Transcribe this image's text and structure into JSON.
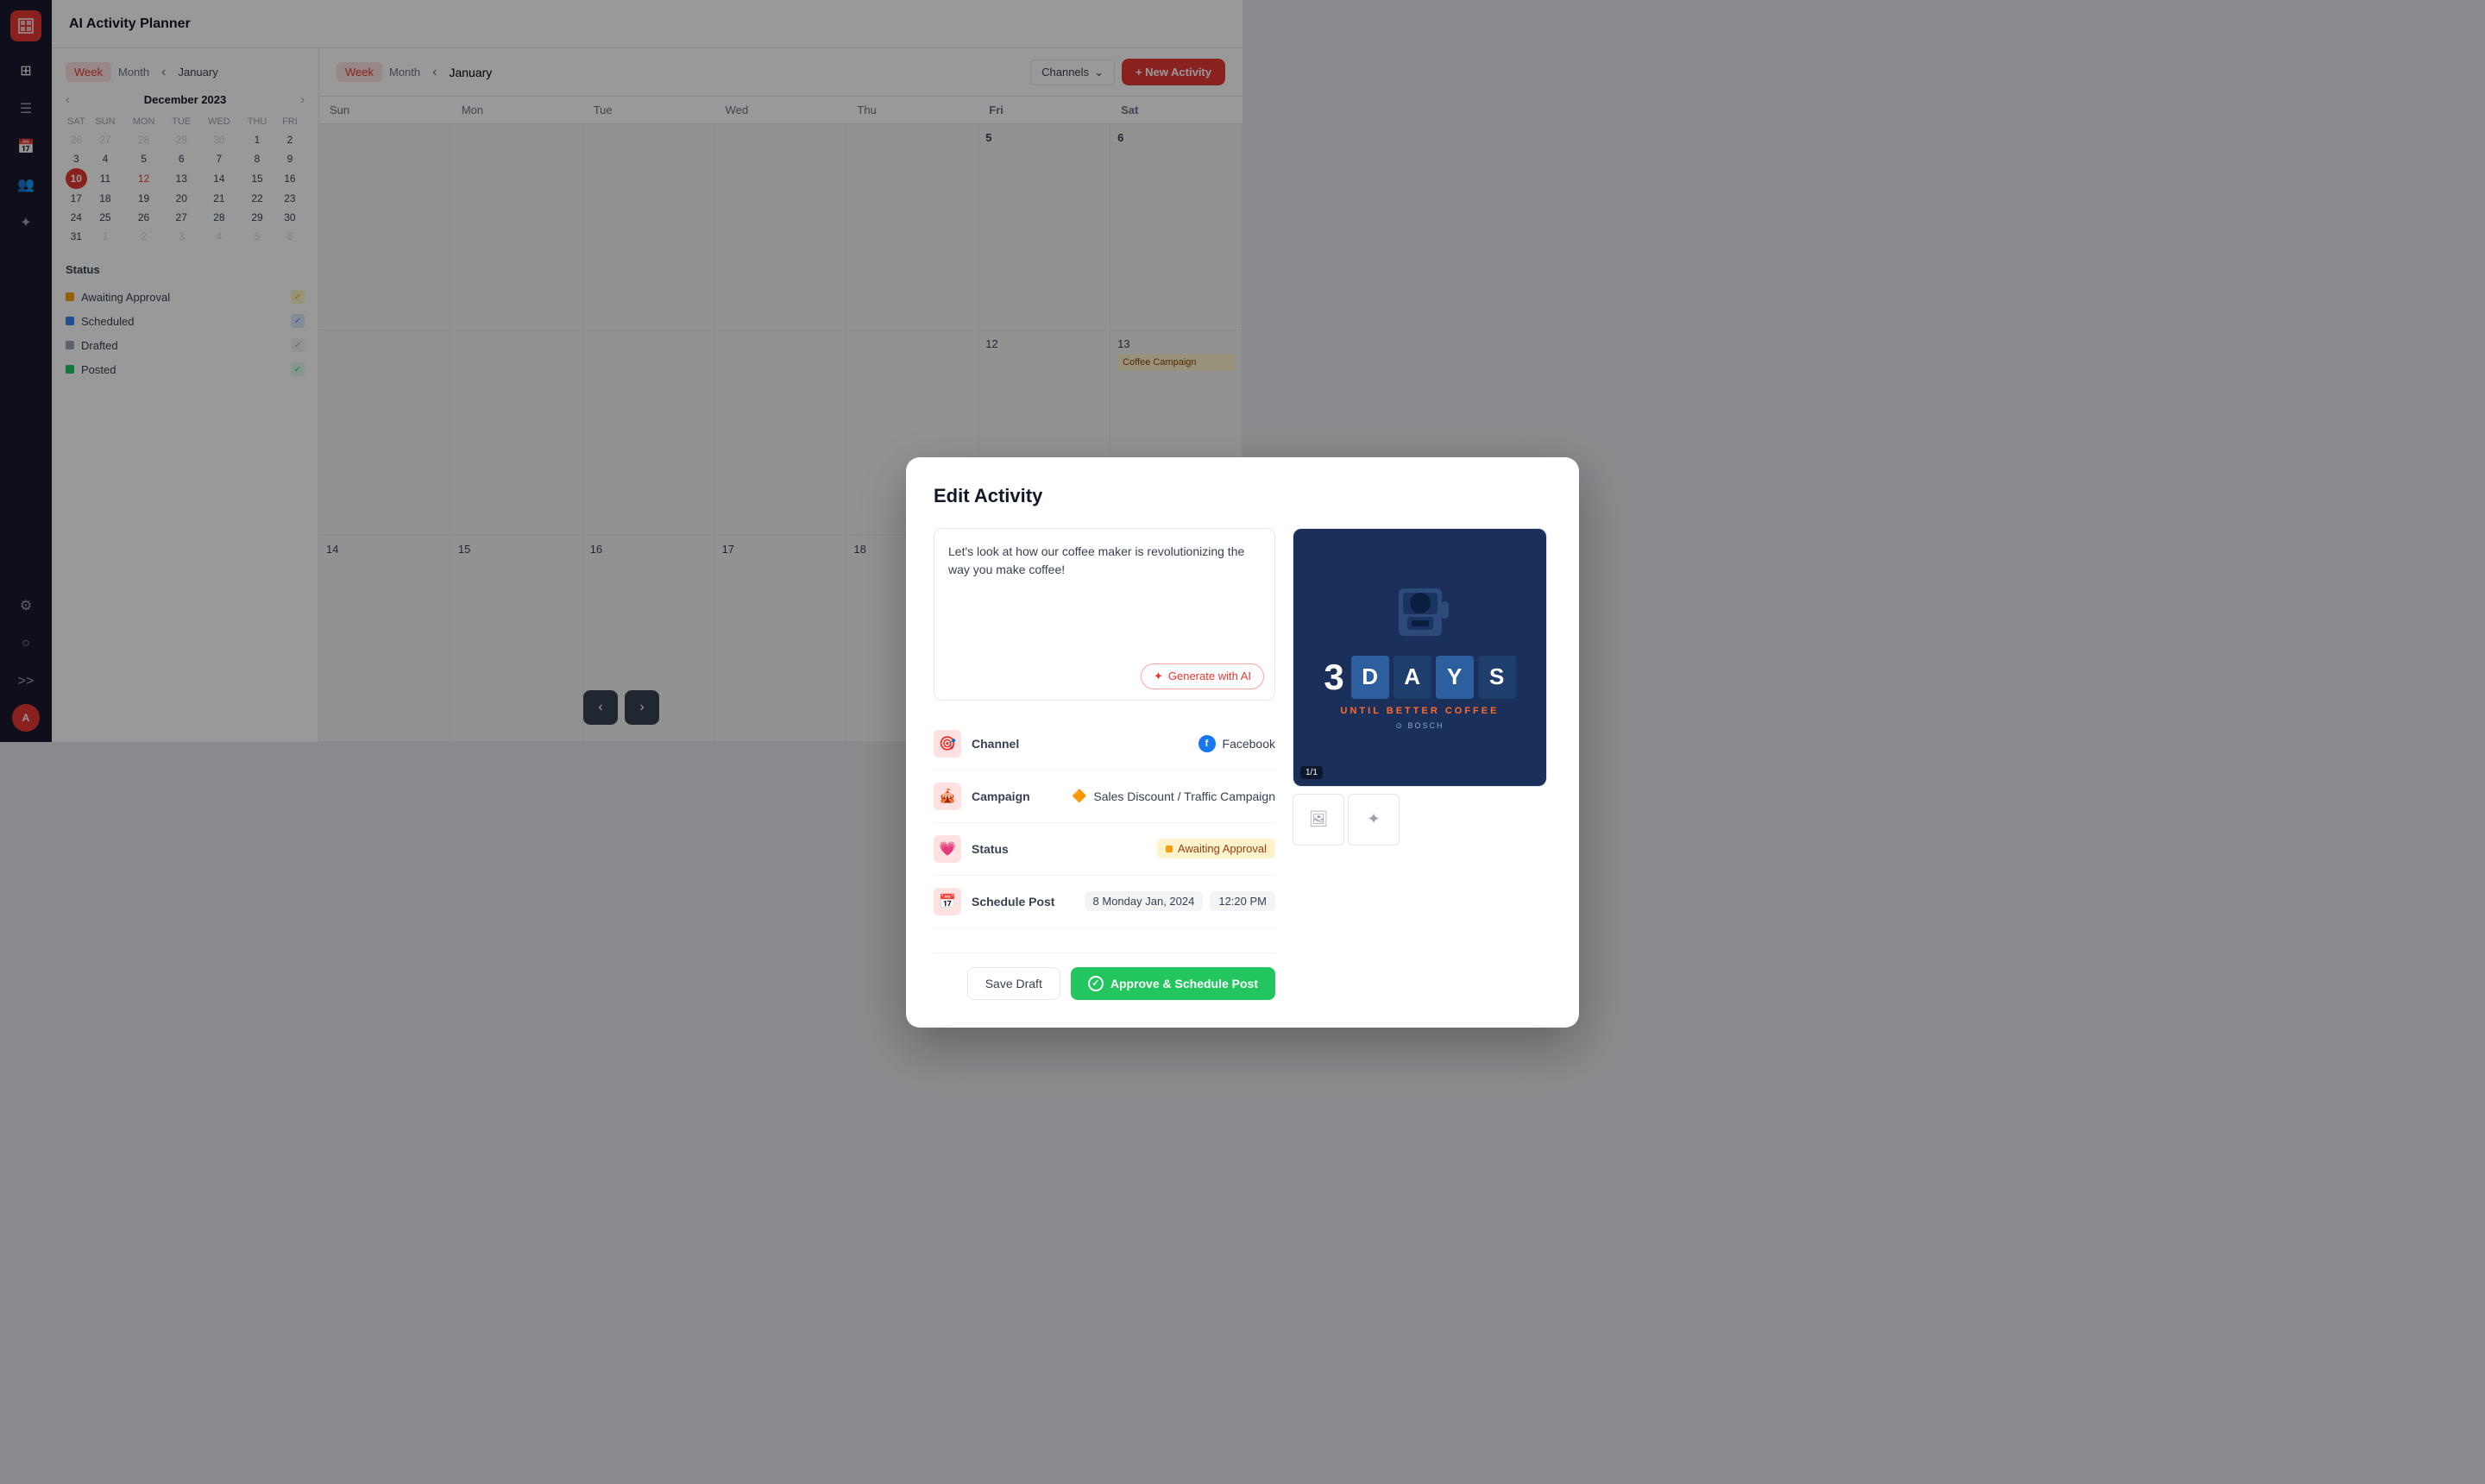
{
  "app": {
    "title": "AI Activity Planner"
  },
  "sidebar": {
    "icons": [
      "≡",
      "📋",
      "📅",
      "👥",
      "✨"
    ]
  },
  "calendar": {
    "view_week": "Week",
    "view_month": "Month",
    "current_period": "January",
    "mini_month": "December 2023",
    "days": [
      "SAT",
      "SUN",
      "MON",
      "TUE",
      "WED",
      "THU",
      "FRI"
    ],
    "weeks": [
      [
        "26",
        "27",
        "28",
        "29",
        "30",
        "1",
        "2"
      ],
      [
        "3",
        "4",
        "5",
        "6",
        "7",
        "8",
        "9"
      ],
      [
        "10",
        "11",
        "12",
        "13",
        "14",
        "15",
        "16"
      ],
      [
        "17",
        "18",
        "19",
        "20",
        "21",
        "22",
        "23"
      ],
      [
        "24",
        "25",
        "26",
        "27",
        "28",
        "29",
        "30"
      ],
      [
        "31",
        "1",
        "2",
        "3",
        "4",
        "5",
        "6"
      ]
    ],
    "today": "10",
    "highlighted": "12",
    "channels_label": "Channels",
    "new_activity_label": "+ New Activity",
    "col_headers": [
      "Fri",
      "Sat"
    ],
    "dates": [
      "5",
      "6",
      "12",
      "13"
    ]
  },
  "status": {
    "title": "Status",
    "items": [
      {
        "label": "Awaiting Approval",
        "color": "#f59e0b",
        "checked": true,
        "check_color": "#f59e0b"
      },
      {
        "label": "Scheduled",
        "color": "#3b82f6",
        "checked": true,
        "check_color": "#3b82f6"
      },
      {
        "label": "Drafted",
        "color": "#9ca3af",
        "checked": true,
        "check_color": "#9ca3af"
      },
      {
        "label": "Posted",
        "color": "#22c55e",
        "checked": true,
        "check_color": "#22c55e"
      }
    ]
  },
  "modal": {
    "title": "Edit Activity",
    "post_text": "Let's look at how our coffee maker is revolutionizing the way you make coffee!",
    "generate_ai_label": "Generate with AI",
    "image_counter": "1/1",
    "fields": {
      "channel": {
        "label": "Channel",
        "icon": "🎯",
        "value": "Facebook"
      },
      "campaign": {
        "label": "Campaign",
        "icon": "🎪",
        "value": "Sales Discount / Traffic Campaign"
      },
      "status": {
        "label": "Status",
        "icon": "💗",
        "value": "Awaiting Approval"
      },
      "schedule": {
        "label": "Schedule Post",
        "icon": "📅",
        "date": "8 Monday Jan, 2024",
        "time": "12:20 PM"
      }
    },
    "save_draft_label": "Save Draft",
    "approve_label": "Approve & Schedule Post"
  },
  "nav_bottom": {
    "prev": "‹",
    "next": "›"
  }
}
